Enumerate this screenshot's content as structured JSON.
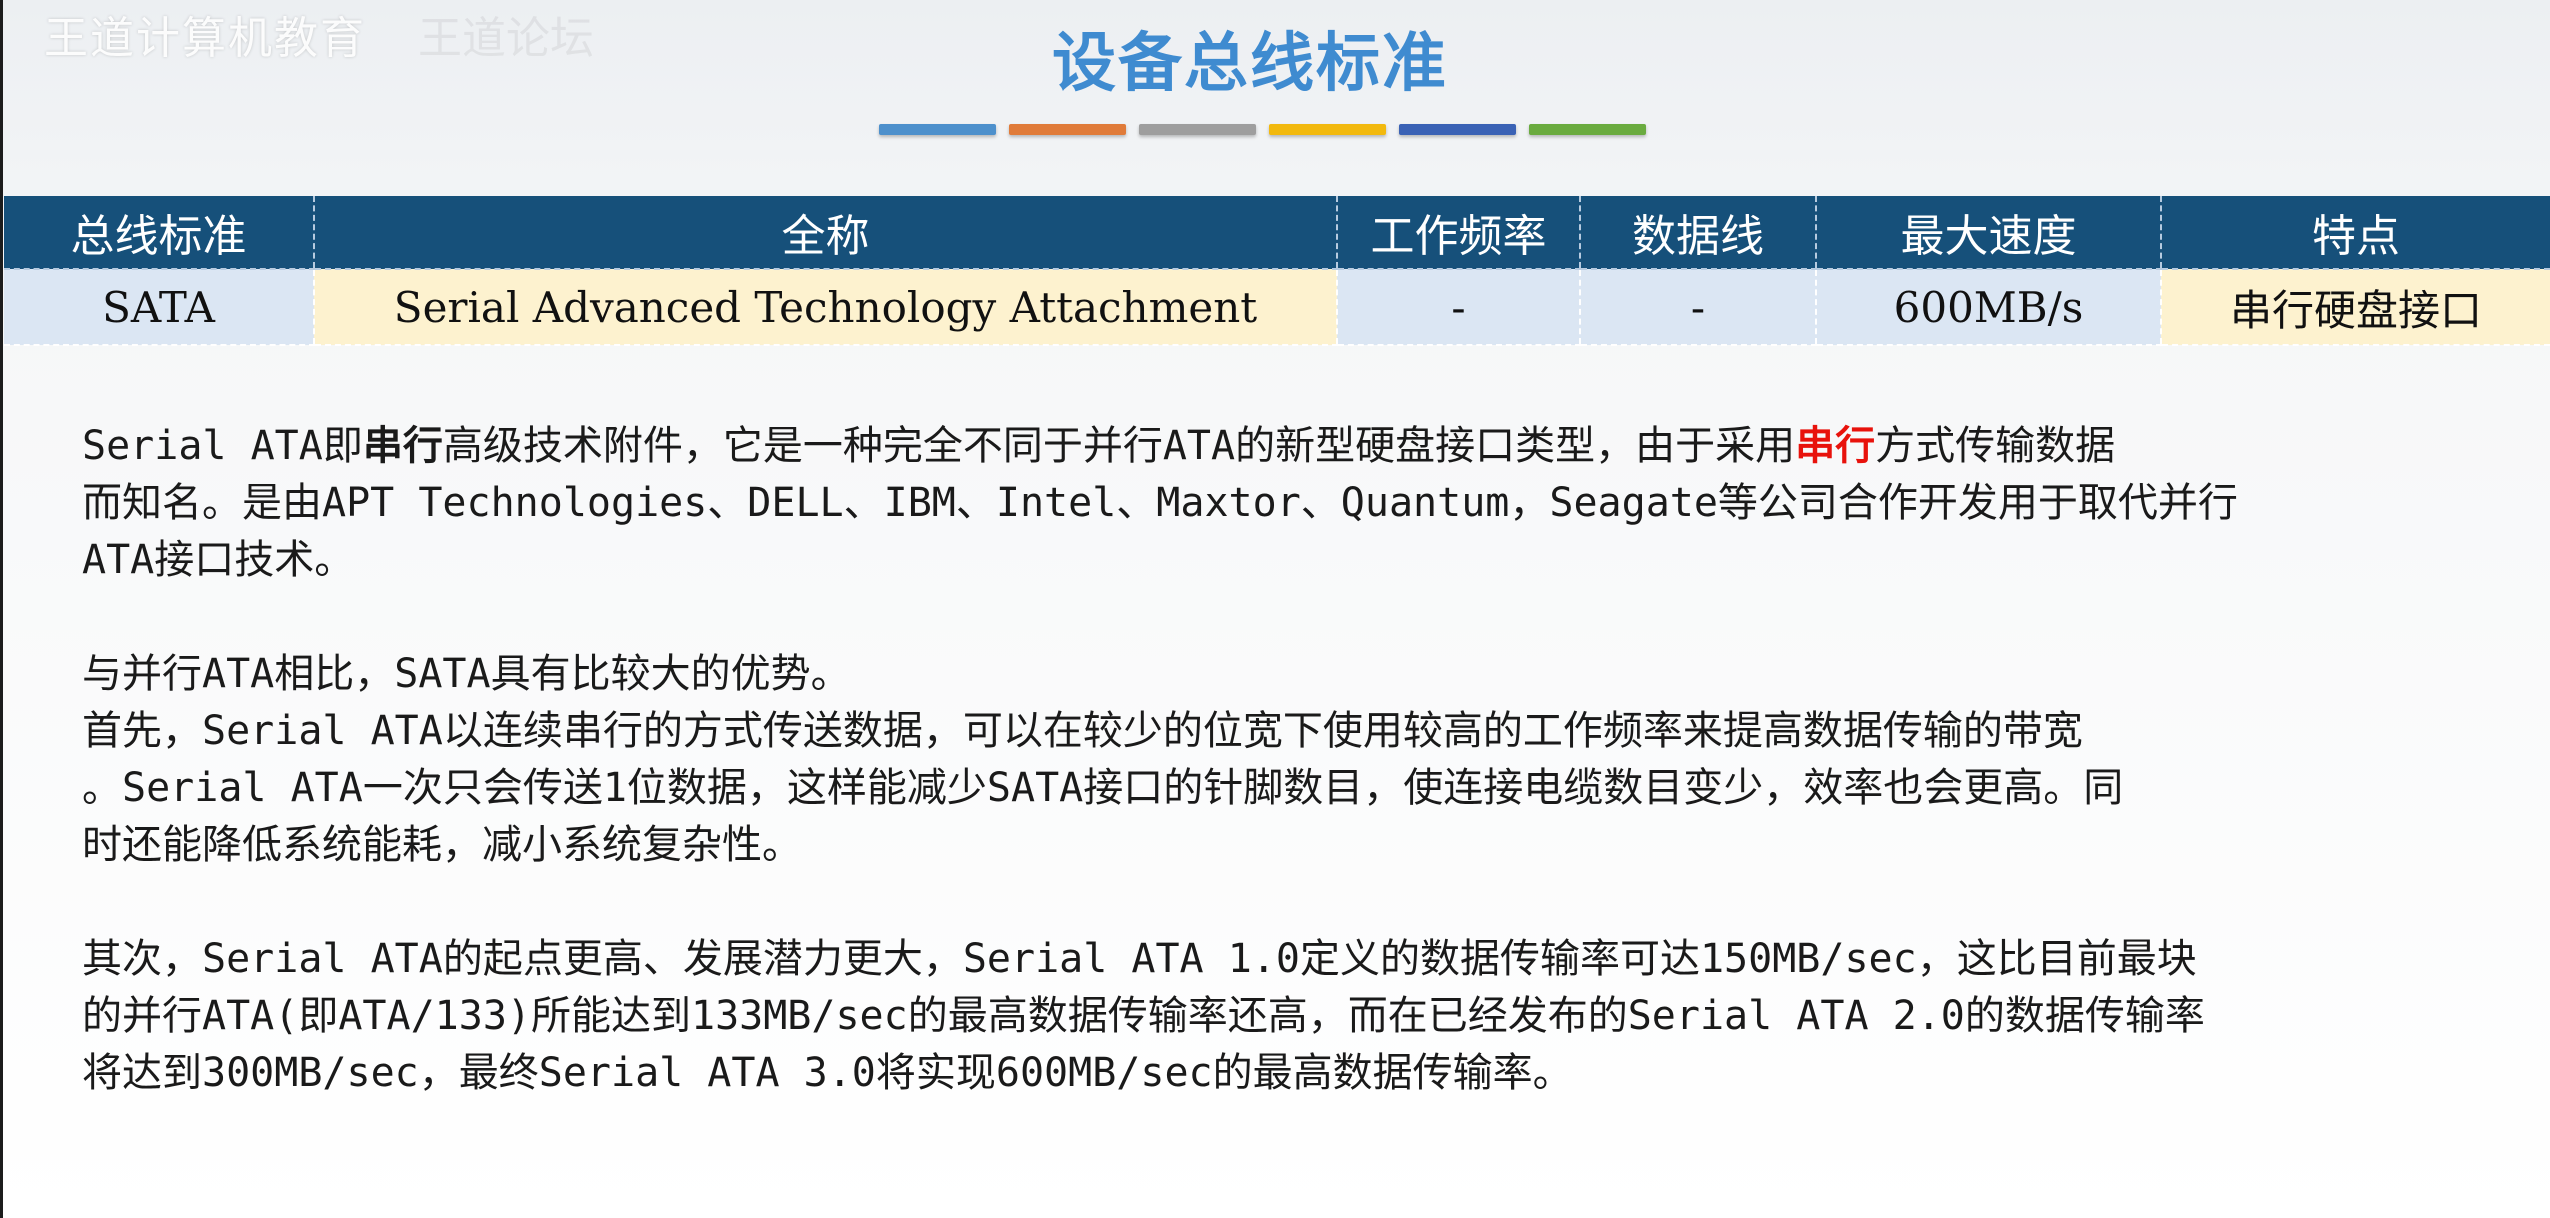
{
  "watermark": {
    "brand": "王道计算机教育",
    "sub": "王道论坛"
  },
  "title": "设备总线标准",
  "accent_bars": [
    "#4d90cc",
    "#e07b39",
    "#9e9e9e",
    "#f2b90e",
    "#3a62b5",
    "#6aab3f"
  ],
  "table": {
    "headers": [
      "总线标准",
      "全称",
      "工作频率",
      "数据线",
      "最大速度",
      "特点"
    ],
    "row": [
      "SATA",
      "Serial Advanced Technology Attachment",
      "-",
      "-",
      "600MB/s",
      "串行硬盘接口"
    ]
  },
  "paragraphs": {
    "p1": {
      "l1_a": "Serial ATA即",
      "l1_b": "串行",
      "l1_c": "高级技术附件，它是一种完全不同于并行ATA的新型硬盘接口类型，由于采用",
      "l1_d": "串行",
      "l1_e": "方式传输数据",
      "l2": "而知名。是由APT Technologies、DELL、IBM、Intel、Maxtor、Quantum，Seagate等公司合作开发用于取代并行",
      "l3": "ATA接口技术。"
    },
    "p2": {
      "l1": "与并行ATA相比，SATA具有比较大的优势。",
      "l2": "首先，Serial ATA以连续串行的方式传送数据，可以在较少的位宽下使用较高的工作频率来提高数据传输的带宽",
      "l3": "。Serial ATA一次只会传送1位数据，这样能减少SATA接口的针脚数目，使连接电缆数目变少，效率也会更高。同",
      "l4": "时还能降低系统能耗，减小系统复杂性。"
    },
    "p3": {
      "l1": "其次，Serial ATA的起点更高、发展潜力更大，Serial ATA 1.0定义的数据传输率可达150MB/sec，这比目前最块",
      "l2": "的并行ATA(即ATA/133)所能达到133MB/sec的最高数据传输率还高，而在已经发布的Serial ATA 2.0的数据传输率",
      "l3": "将达到300MB/sec，最终Serial ATA 3.0将实现600MB/sec的最高数据传输率。"
    }
  }
}
